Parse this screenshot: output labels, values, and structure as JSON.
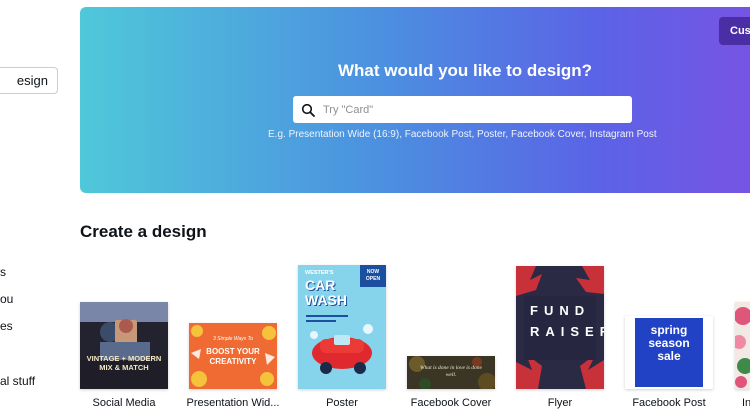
{
  "sidebar": {
    "create_button_label": "Create a design",
    "items": [
      "Your designs",
      "Shared with you",
      "Brand templates",
      "Personal stuff"
    ],
    "visible_fragments": [
      "s",
      "ou",
      "es",
      "al stuff"
    ]
  },
  "hero": {
    "title": "What would you like to design?",
    "custom_button_label": "Custom dimensions",
    "custom_button_visible": "Cust",
    "search": {
      "placeholder": "Try \"Card\""
    },
    "suggestions_prefix": "E.g.",
    "suggestions": [
      "Presentation Wide (16:9)",
      "Facebook Post",
      "Poster",
      "Facebook Cover",
      "Instagram Post"
    ]
  },
  "create_section": {
    "title": "Create a design",
    "cards": [
      {
        "label": "Social Media",
        "thumb_text": "VINTAGE + MODERN MIX & MATCH"
      },
      {
        "label": "Presentation Wid...",
        "thumb_text_small": "3 Simple Ways To",
        "thumb_text": "BOOST YOUR CREATIVITY"
      },
      {
        "label": "Poster",
        "thumb_kicker": "WESTER'S",
        "thumb_text": "CAR WASH",
        "thumb_badge": "NOW OPEN"
      },
      {
        "label": "Facebook Cover",
        "thumb_text": "What is done in love is done well."
      },
      {
        "label": "Flyer",
        "thumb_text": "FUND RAISER"
      },
      {
        "label": "Facebook Post",
        "thumb_text": "spring season sale"
      },
      {
        "label": "In"
      }
    ]
  },
  "colors": {
    "hero_gradient_start": "#4fc8d9",
    "hero_gradient_end": "#7a52e3",
    "custom_button_bg": "#4a2ea6"
  }
}
